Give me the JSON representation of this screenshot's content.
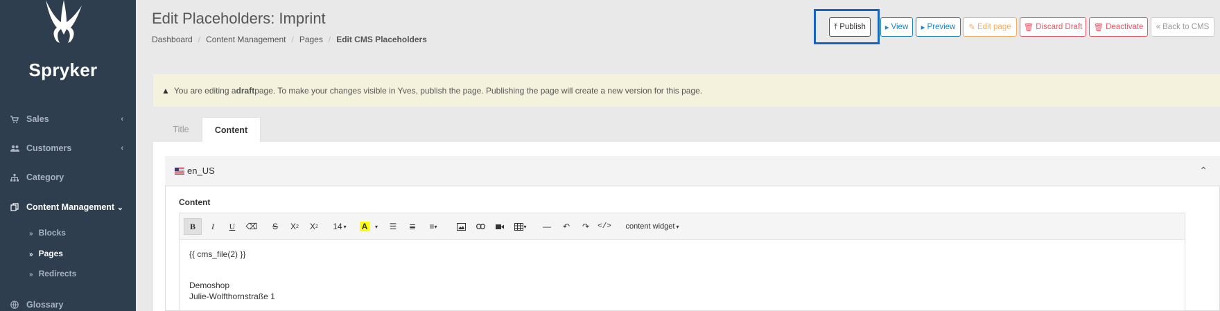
{
  "sidebar": {
    "brand": "Spryker",
    "items": [
      {
        "label": "Sales",
        "icon": "cart-icon"
      },
      {
        "label": "Customers",
        "icon": "users-icon"
      },
      {
        "label": "Category",
        "icon": "sitemap-icon"
      },
      {
        "label": "Content Management",
        "icon": "files-icon"
      },
      {
        "label": "Glossary",
        "icon": "globe-icon"
      }
    ],
    "sub_items": [
      {
        "label": "Blocks"
      },
      {
        "label": "Pages"
      },
      {
        "label": "Redirects"
      }
    ]
  },
  "header": {
    "title": "Edit Placeholders: Imprint",
    "breadcrumb": [
      "Dashboard",
      "Content Management",
      "Pages",
      "Edit CMS Placeholders"
    ]
  },
  "actions": {
    "publish": "Publish",
    "view": "View",
    "preview": "Preview",
    "edit_page": "Edit page",
    "discard_draft": "Discard Draft",
    "deactivate": "Deactivate",
    "back": "Back to CMS"
  },
  "alert": {
    "prefix": "You are editing a ",
    "emphasis": "draft",
    "suffix": " page. To make your changes visible in Yves, publish the page. Publishing the page will create a new version for this page."
  },
  "tabs": [
    "Title",
    "Content"
  ],
  "locale": "en_US",
  "editor": {
    "label": "Content",
    "font_size": "14",
    "widget_label": "content widget",
    "lines": [
      "{{ cms_file(2) }}",
      "Demoshop",
      "Julie-Wolfthornstraße 1"
    ]
  },
  "colors": {
    "sidebar_bg": "#2e3e4e",
    "primary": "#1c84c6",
    "warning": "#f8ac59",
    "danger": "#ed5565",
    "highlight_box": "#1565c0"
  }
}
